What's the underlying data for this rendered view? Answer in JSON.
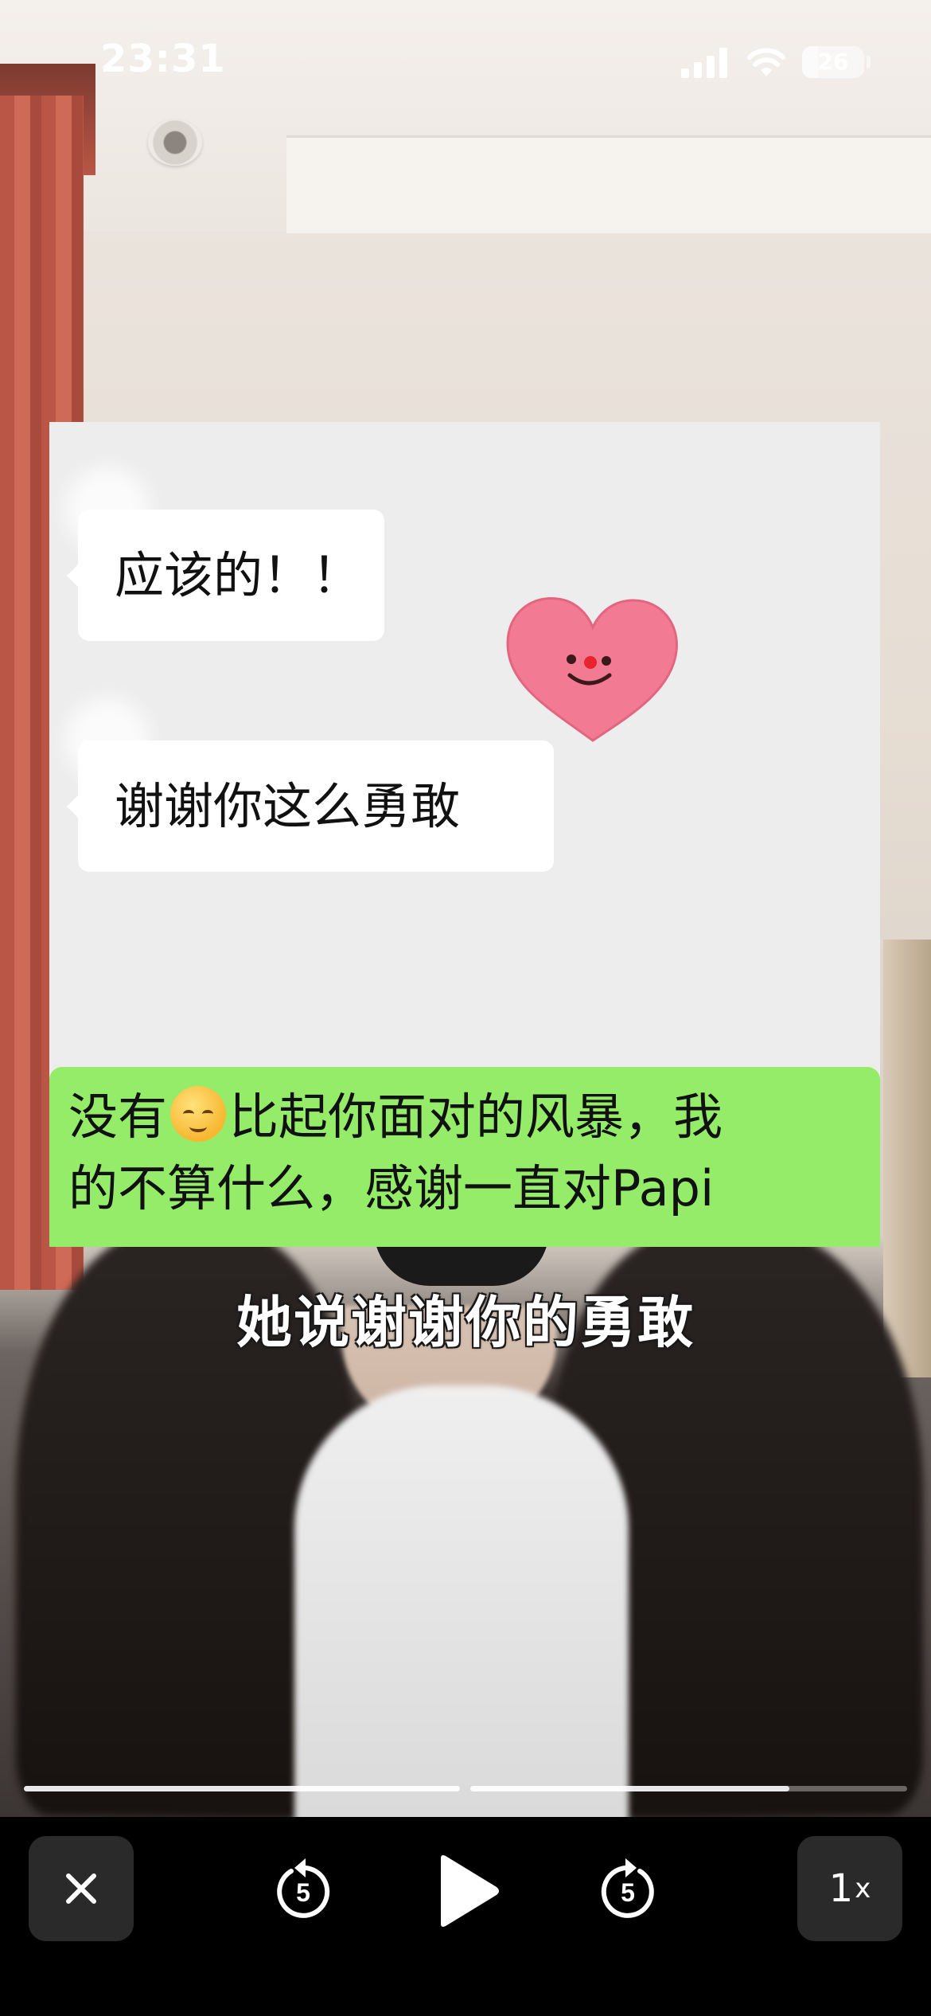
{
  "status_bar": {
    "time": "23:31",
    "battery": "26",
    "battery_level": 0.26
  },
  "chat": {
    "incoming": [
      {
        "text": "应该的！！"
      },
      {
        "text": "谢谢你这么勇敢"
      }
    ],
    "outgoing": {
      "line1_before_emoji": "没有",
      "emoji": "relieved-face",
      "line1_after_emoji": "比起你面对的风暴，我",
      "line2": "的不算什么，感谢一直对Papi"
    },
    "sticker": "smiling-heart-sticker"
  },
  "subtitle": "她说谢谢你的勇敢",
  "playback": {
    "segments": [
      {
        "progress": 1.0
      },
      {
        "progress": 0.73
      }
    ],
    "skip_back_seconds": "5",
    "skip_forward_seconds": "5",
    "speed": "1",
    "speed_suffix": "x"
  },
  "colors": {
    "outgoing_bubble": "#95ec69",
    "incoming_bubble": "#ffffff",
    "chat_background": "#ededed",
    "controls_background": "#000000"
  }
}
